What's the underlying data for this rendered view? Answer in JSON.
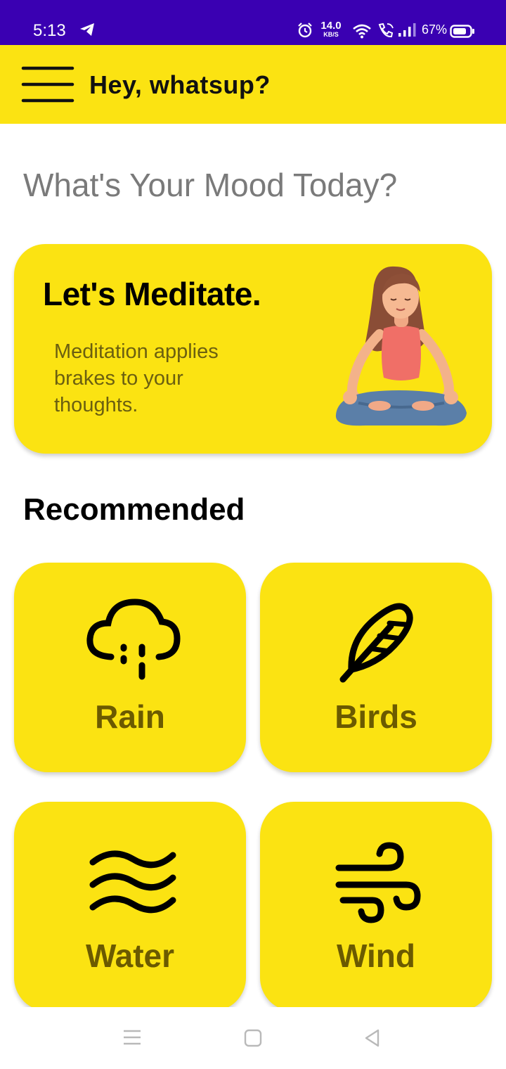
{
  "status_bar": {
    "time": "5:13",
    "net_speed_value": "14.0",
    "net_speed_unit": "KB/S",
    "battery": "67%",
    "icons": [
      "telegram-icon",
      "alarm-icon",
      "wifi-icon",
      "wifi-call-icon",
      "signal-icon",
      "battery-icon"
    ]
  },
  "app_bar": {
    "title": "Hey, whatsup?",
    "menu_icon": "hamburger-menu-icon",
    "background": "#fbe312"
  },
  "mood_heading": "What's Your Mood Today?",
  "meditate_card": {
    "title": "Let's Meditate.",
    "description": "Meditation applies brakes to your thoughts.",
    "illustration": "meditating-woman"
  },
  "recommended": {
    "heading": "Recommended",
    "items": [
      {
        "label": "Rain",
        "icon": "rain-cloud-icon"
      },
      {
        "label": "Birds",
        "icon": "feather-icon"
      },
      {
        "label": "Water",
        "icon": "waves-icon"
      },
      {
        "label": "Wind",
        "icon": "wind-icon"
      }
    ]
  },
  "nav_bar": {
    "buttons": [
      "recents-icon",
      "home-icon",
      "back-icon"
    ]
  },
  "colors": {
    "status_bar": "#3a00b2",
    "accent_yellow": "#fbe312",
    "tile_label": "#6b5a00",
    "heading_gray": "#7a7a7a"
  }
}
